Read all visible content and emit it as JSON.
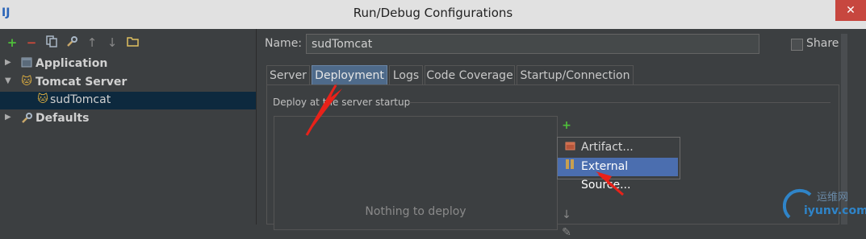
{
  "window": {
    "title": "Run/Debug Configurations",
    "app_glyph": "IJ",
    "close_glyph": "✕"
  },
  "toolbar": {
    "icons": [
      "add-icon",
      "remove-icon",
      "copy-icon",
      "wrench-icon",
      "move-up-icon",
      "move-down-icon",
      "folder-icon"
    ]
  },
  "tree": {
    "items": [
      {
        "label": "Application",
        "icon": "application-icon"
      },
      {
        "label": "Tomcat Server",
        "icon": "tomcat-icon"
      },
      {
        "label": "sudTomcat",
        "icon": "tomcat-icon"
      },
      {
        "label": "Defaults",
        "icon": "wrench-icon"
      }
    ]
  },
  "form": {
    "name_label": "Name:",
    "name_value": "sudTomcat",
    "share_label": "Share",
    "share_checked": false
  },
  "tabs": [
    {
      "label": "Server"
    },
    {
      "label": "Deployment"
    },
    {
      "label": "Logs"
    },
    {
      "label": "Code Coverage"
    },
    {
      "label": "Startup/Connection"
    }
  ],
  "deployment": {
    "section_label": "Deploy at the server startup",
    "empty_text": "Nothing to deploy"
  },
  "popup": {
    "items": [
      {
        "label": "Artifact...",
        "icon": "artifact-icon"
      },
      {
        "label": "External Source...",
        "icon": "external-source-icon"
      }
    ]
  },
  "colors": {
    "accent": "#4b6eaf",
    "arrow": "#e8221a",
    "selection": "#0d293e"
  },
  "watermark": {
    "text": "运维网",
    "url": "iyunv.com"
  }
}
